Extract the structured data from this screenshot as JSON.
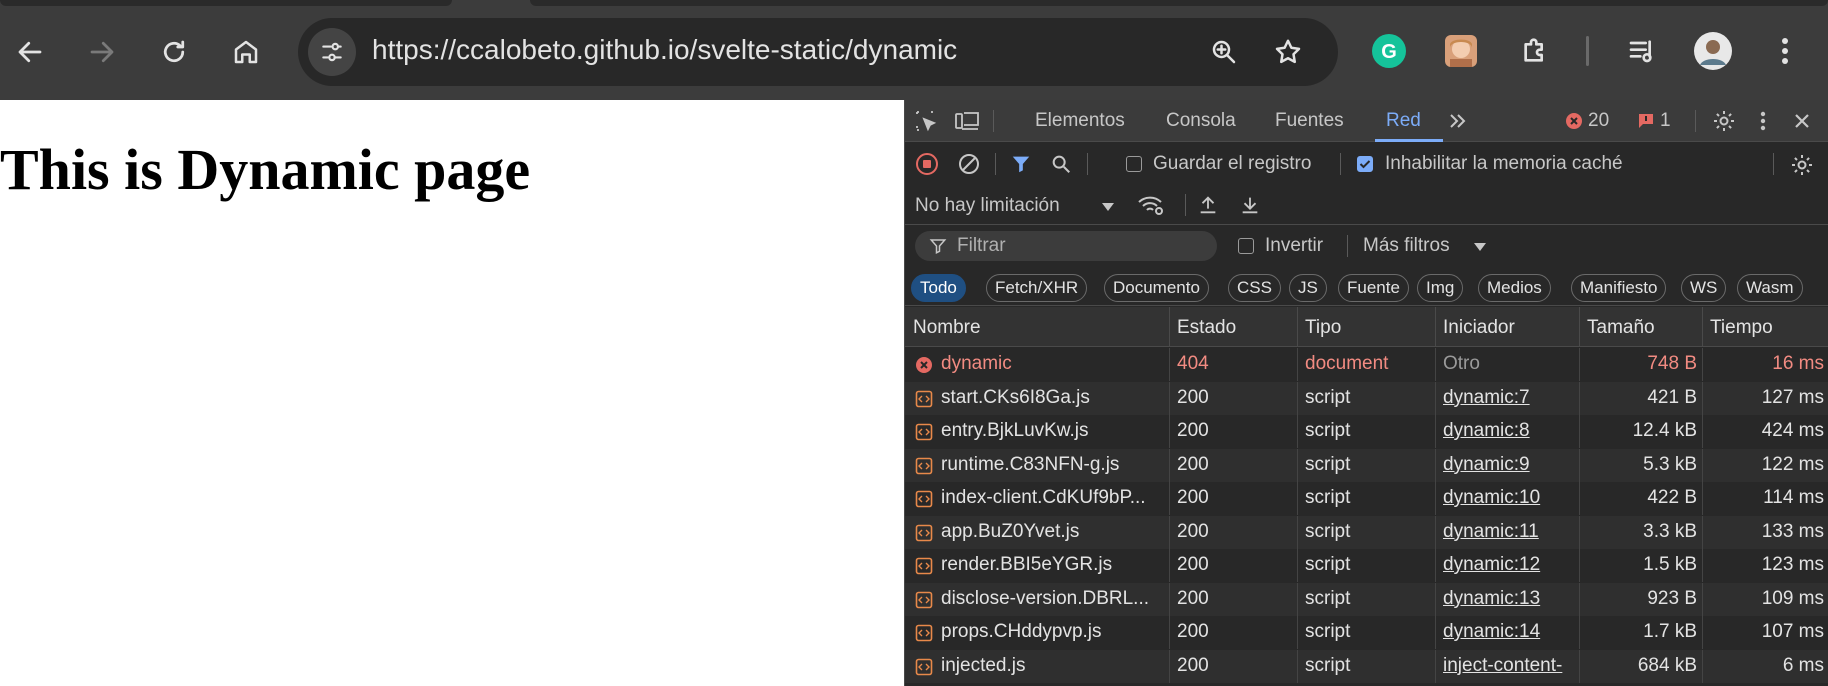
{
  "browser": {
    "url": "https://ccalobeto.github.io/svelte-static/dynamic",
    "icons": {
      "back": "arrow-left-icon",
      "forward": "arrow-right-icon",
      "reload": "reload-icon",
      "home": "home-icon",
      "site_info": "tune-icon",
      "zoom": "zoom-icon",
      "bookmark": "star-icon",
      "extensions": "puzzle-icon",
      "media": "media-control-icon",
      "menu": "kebab-menu-icon"
    }
  },
  "page": {
    "heading": "This is Dynamic page"
  },
  "devtools": {
    "tabs": [
      {
        "label": "Elementos"
      },
      {
        "label": "Consola"
      },
      {
        "label": "Fuentes"
      },
      {
        "label": "Red"
      }
    ],
    "active_tab": "Red",
    "error_count": "20",
    "issue_count": "1",
    "toolbar": {
      "preserve_log_label": "Guardar el registro",
      "preserve_log_checked": false,
      "disable_cache_label": "Inhabilitar la memoria caché",
      "disable_cache_checked": true,
      "throttling_value": "No hay limitación"
    },
    "filter": {
      "placeholder": "Filtrar",
      "invert_label": "Invertir",
      "more_filters_label": "Más filtros"
    },
    "type_chips": [
      "Todo",
      "Fetch/XHR",
      "Documento",
      "CSS",
      "JS",
      "Fuente",
      "Img",
      "Medios",
      "Manifiesto",
      "WS",
      "Wasm"
    ],
    "active_chip": "Todo",
    "table": {
      "columns": [
        "Nombre",
        "Estado",
        "Tipo",
        "Iniciador",
        "Tamaño",
        "Tiempo"
      ],
      "rows": [
        {
          "name": "dynamic",
          "status": "404",
          "type": "document",
          "initiator": "Otro",
          "size": "748 B",
          "time": "16 ms",
          "error": true
        },
        {
          "name": "start.CKs6I8Ga.js",
          "status": "200",
          "type": "script",
          "initiator": "dynamic:7",
          "size": "421 B",
          "time": "127 ms"
        },
        {
          "name": "entry.BjkLuvKw.js",
          "status": "200",
          "type": "script",
          "initiator": "dynamic:8",
          "size": "12.4 kB",
          "time": "424 ms"
        },
        {
          "name": "runtime.C83NFN-g.js",
          "status": "200",
          "type": "script",
          "initiator": "dynamic:9",
          "size": "5.3 kB",
          "time": "122 ms"
        },
        {
          "name": "index-client.CdKUf9bP...",
          "status": "200",
          "type": "script",
          "initiator": "dynamic:10",
          "size": "422 B",
          "time": "114 ms"
        },
        {
          "name": "app.BuZ0Yvet.js",
          "status": "200",
          "type": "script",
          "initiator": "dynamic:11",
          "size": "3.3 kB",
          "time": "133 ms"
        },
        {
          "name": "render.BBI5eYGR.js",
          "status": "200",
          "type": "script",
          "initiator": "dynamic:12",
          "size": "1.5 kB",
          "time": "123 ms"
        },
        {
          "name": "disclose-version.DBRL...",
          "status": "200",
          "type": "script",
          "initiator": "dynamic:13",
          "size": "923 B",
          "time": "109 ms"
        },
        {
          "name": "props.CHddypvp.js",
          "status": "200",
          "type": "script",
          "initiator": "dynamic:14",
          "size": "1.7 kB",
          "time": "107 ms"
        },
        {
          "name": "injected.js",
          "status": "200",
          "type": "script",
          "initiator": "inject-content-",
          "size": "684 kB",
          "time": "6 ms"
        }
      ]
    }
  }
}
